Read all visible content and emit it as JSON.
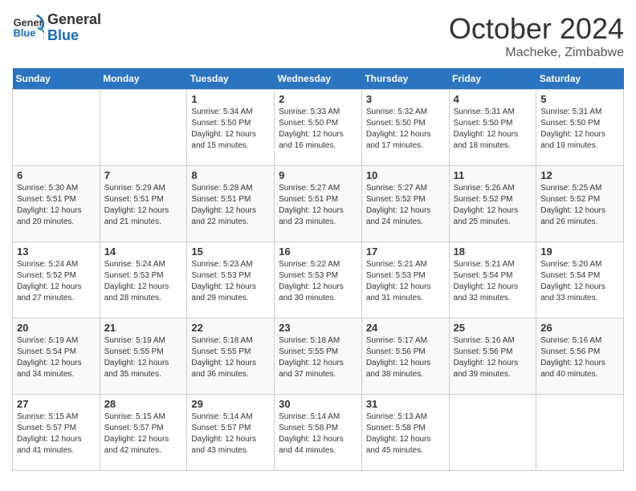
{
  "logo": {
    "line1": "General",
    "line2": "Blue"
  },
  "title": "October 2024",
  "location": "Macheke, Zimbabwe",
  "days_header": [
    "Sunday",
    "Monday",
    "Tuesday",
    "Wednesday",
    "Thursday",
    "Friday",
    "Saturday"
  ],
  "weeks": [
    [
      {
        "num": "",
        "info": ""
      },
      {
        "num": "",
        "info": ""
      },
      {
        "num": "1",
        "info": "Sunrise: 5:34 AM\nSunset: 5:50 PM\nDaylight: 12 hours and 15 minutes."
      },
      {
        "num": "2",
        "info": "Sunrise: 5:33 AM\nSunset: 5:50 PM\nDaylight: 12 hours and 16 minutes."
      },
      {
        "num": "3",
        "info": "Sunrise: 5:32 AM\nSunset: 5:50 PM\nDaylight: 12 hours and 17 minutes."
      },
      {
        "num": "4",
        "info": "Sunrise: 5:31 AM\nSunset: 5:50 PM\nDaylight: 12 hours and 18 minutes."
      },
      {
        "num": "5",
        "info": "Sunrise: 5:31 AM\nSunset: 5:50 PM\nDaylight: 12 hours and 19 minutes."
      }
    ],
    [
      {
        "num": "6",
        "info": "Sunrise: 5:30 AM\nSunset: 5:51 PM\nDaylight: 12 hours and 20 minutes."
      },
      {
        "num": "7",
        "info": "Sunrise: 5:29 AM\nSunset: 5:51 PM\nDaylight: 12 hours and 21 minutes."
      },
      {
        "num": "8",
        "info": "Sunrise: 5:28 AM\nSunset: 5:51 PM\nDaylight: 12 hours and 22 minutes."
      },
      {
        "num": "9",
        "info": "Sunrise: 5:27 AM\nSunset: 5:51 PM\nDaylight: 12 hours and 23 minutes."
      },
      {
        "num": "10",
        "info": "Sunrise: 5:27 AM\nSunset: 5:52 PM\nDaylight: 12 hours and 24 minutes."
      },
      {
        "num": "11",
        "info": "Sunrise: 5:26 AM\nSunset: 5:52 PM\nDaylight: 12 hours and 25 minutes."
      },
      {
        "num": "12",
        "info": "Sunrise: 5:25 AM\nSunset: 5:52 PM\nDaylight: 12 hours and 26 minutes."
      }
    ],
    [
      {
        "num": "13",
        "info": "Sunrise: 5:24 AM\nSunset: 5:52 PM\nDaylight: 12 hours and 27 minutes."
      },
      {
        "num": "14",
        "info": "Sunrise: 5:24 AM\nSunset: 5:53 PM\nDaylight: 12 hours and 28 minutes."
      },
      {
        "num": "15",
        "info": "Sunrise: 5:23 AM\nSunset: 5:53 PM\nDaylight: 12 hours and 29 minutes."
      },
      {
        "num": "16",
        "info": "Sunrise: 5:22 AM\nSunset: 5:53 PM\nDaylight: 12 hours and 30 minutes."
      },
      {
        "num": "17",
        "info": "Sunrise: 5:21 AM\nSunset: 5:53 PM\nDaylight: 12 hours and 31 minutes."
      },
      {
        "num": "18",
        "info": "Sunrise: 5:21 AM\nSunset: 5:54 PM\nDaylight: 12 hours and 32 minutes."
      },
      {
        "num": "19",
        "info": "Sunrise: 5:20 AM\nSunset: 5:54 PM\nDaylight: 12 hours and 33 minutes."
      }
    ],
    [
      {
        "num": "20",
        "info": "Sunrise: 5:19 AM\nSunset: 5:54 PM\nDaylight: 12 hours and 34 minutes."
      },
      {
        "num": "21",
        "info": "Sunrise: 5:19 AM\nSunset: 5:55 PM\nDaylight: 12 hours and 35 minutes."
      },
      {
        "num": "22",
        "info": "Sunrise: 5:18 AM\nSunset: 5:55 PM\nDaylight: 12 hours and 36 minutes."
      },
      {
        "num": "23",
        "info": "Sunrise: 5:18 AM\nSunset: 5:55 PM\nDaylight: 12 hours and 37 minutes."
      },
      {
        "num": "24",
        "info": "Sunrise: 5:17 AM\nSunset: 5:56 PM\nDaylight: 12 hours and 38 minutes."
      },
      {
        "num": "25",
        "info": "Sunrise: 5:16 AM\nSunset: 5:56 PM\nDaylight: 12 hours and 39 minutes."
      },
      {
        "num": "26",
        "info": "Sunrise: 5:16 AM\nSunset: 5:56 PM\nDaylight: 12 hours and 40 minutes."
      }
    ],
    [
      {
        "num": "27",
        "info": "Sunrise: 5:15 AM\nSunset: 5:57 PM\nDaylight: 12 hours and 41 minutes."
      },
      {
        "num": "28",
        "info": "Sunrise: 5:15 AM\nSunset: 5:57 PM\nDaylight: 12 hours and 42 minutes."
      },
      {
        "num": "29",
        "info": "Sunrise: 5:14 AM\nSunset: 5:57 PM\nDaylight: 12 hours and 43 minutes."
      },
      {
        "num": "30",
        "info": "Sunrise: 5:14 AM\nSunset: 5:58 PM\nDaylight: 12 hours and 44 minutes."
      },
      {
        "num": "31",
        "info": "Sunrise: 5:13 AM\nSunset: 5:58 PM\nDaylight: 12 hours and 45 minutes."
      },
      {
        "num": "",
        "info": ""
      },
      {
        "num": "",
        "info": ""
      }
    ]
  ]
}
